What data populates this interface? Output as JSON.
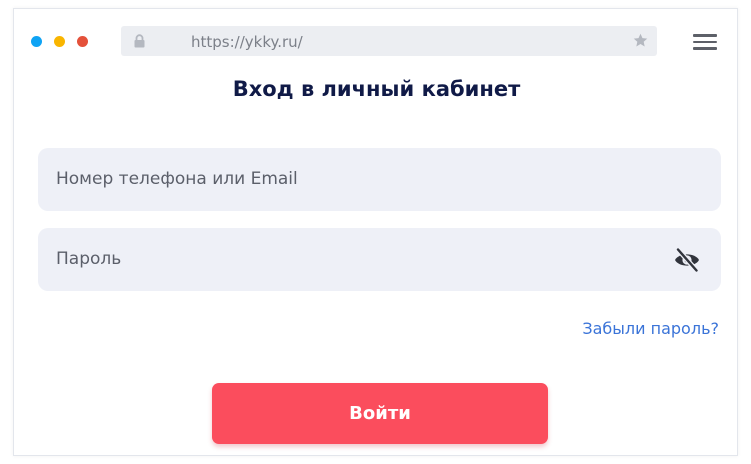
{
  "browser": {
    "url": "https://ykky.ru/"
  },
  "page": {
    "title": "Вход в личный кабинет"
  },
  "form": {
    "login_placeholder": "Номер телефона или Email",
    "password_placeholder": "Пароль",
    "forgot_password_label": "Забыли пароль?",
    "submit_label": "Войти"
  },
  "icons": {
    "window_controls": [
      "dot-blue",
      "dot-yellow",
      "dot-red"
    ],
    "address_bar": [
      "lock-icon",
      "star-icon"
    ],
    "menu": "hamburger-menu-icon",
    "password_toggle": "eye-slash-icon"
  },
  "colors": {
    "title": "#101a47",
    "field_background": "#eef0f7",
    "link": "#3b74d8",
    "button": "#fb4d5d",
    "dot_blue": "#0fa3f4",
    "dot_yellow": "#f9b500",
    "dot_red": "#e4513a"
  }
}
